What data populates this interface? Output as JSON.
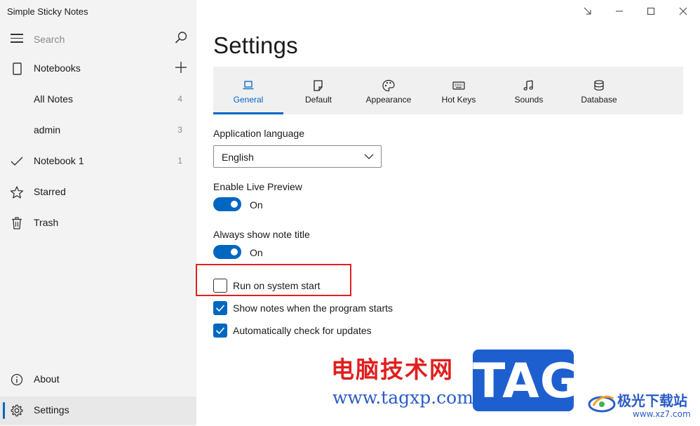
{
  "app": {
    "title": "Simple Sticky Notes"
  },
  "sidebar": {
    "search_placeholder": "Search",
    "notebooks_label": "Notebooks",
    "items": [
      {
        "label": "All Notes",
        "count": "4"
      },
      {
        "label": "admin",
        "count": "3"
      },
      {
        "label": "Notebook 1",
        "count": "1"
      },
      {
        "label": "Starred"
      },
      {
        "label": "Trash"
      }
    ],
    "about_label": "About",
    "settings_label": "Settings"
  },
  "main": {
    "page_title": "Settings",
    "tabs": [
      {
        "label": "General",
        "icon": "laptop-icon",
        "active": true
      },
      {
        "label": "Default",
        "icon": "note-icon"
      },
      {
        "label": "Appearance",
        "icon": "palette-icon"
      },
      {
        "label": "Hot Keys",
        "icon": "keyboard-icon"
      },
      {
        "label": "Sounds",
        "icon": "music-note-icon"
      },
      {
        "label": "Database",
        "icon": "database-icon"
      }
    ],
    "language": {
      "label": "Application language",
      "value": "English"
    },
    "live_preview": {
      "label": "Enable Live Preview",
      "state": "On"
    },
    "show_title": {
      "label": "Always show note title",
      "state": "On"
    },
    "checkboxes": [
      {
        "label": "Run on system start",
        "checked": false
      },
      {
        "label": "Show notes when the program starts",
        "checked": true
      },
      {
        "label": "Automatically check for updates",
        "checked": true
      }
    ]
  },
  "watermark": {
    "site_cn": "电脑技术网",
    "site_url": "www.tagxp.com",
    "tag": "TAG",
    "brand_cn": "极光下载站",
    "brand_url": "www.xz7.com"
  },
  "colors": {
    "accent": "#0067c0",
    "highlight": "#e02020",
    "sidebar_bg": "#f3f3f3"
  }
}
